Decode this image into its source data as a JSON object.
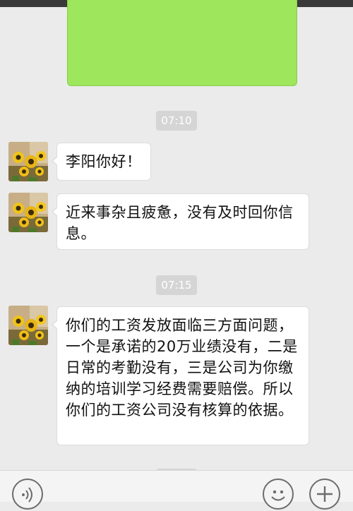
{
  "messages": [
    {
      "time": "07:10",
      "text": "李阳你好！"
    },
    {
      "time": "",
      "text": "近来事杂且疲惫，没有及时回你信息。"
    },
    {
      "time": "07:15",
      "text": "你们的工资发放面临三方面问题，一个是承诺的20万业绩没有，二是日常的考勤没有，三是公司为你缴纳的培训学习经费需要赔偿。所以你们的工资公司没有核算的依据。"
    }
  ],
  "icons": {
    "voice": "voice-icon",
    "emoji": "emoji-icon",
    "more": "plus-icon"
  },
  "colors": {
    "sent_bubble": "#9ee65b",
    "received_bubble": "#ffffff",
    "chat_background": "#ebebeb"
  }
}
